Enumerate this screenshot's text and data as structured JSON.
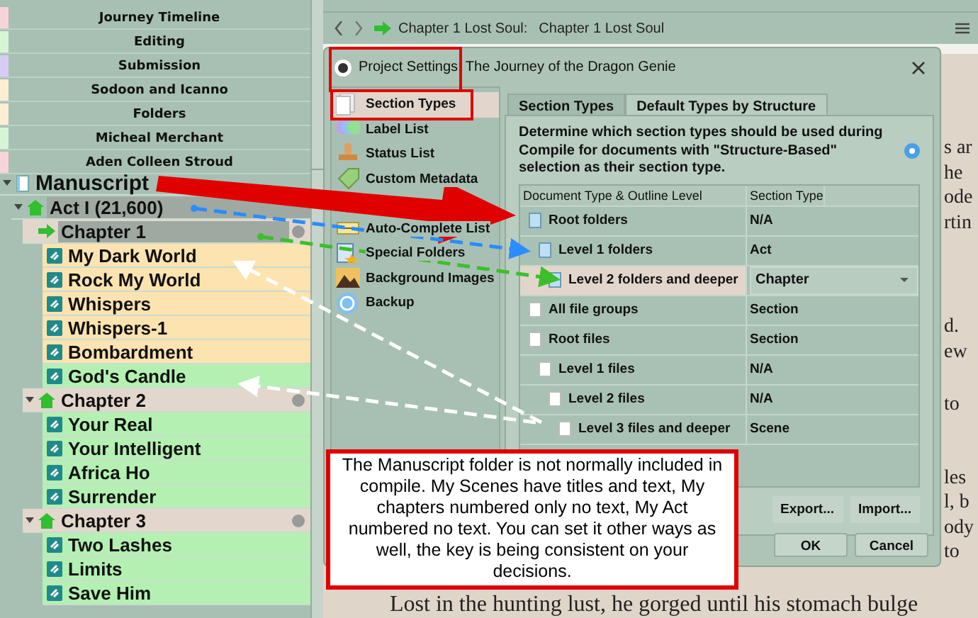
{
  "collections": [
    {
      "label": "Journey Timeline",
      "color": "#f7d3da"
    },
    {
      "label": "Editing",
      "color": "#d6f5d6"
    },
    {
      "label": "Submission",
      "color": "#d9ccf4"
    },
    {
      "label": "Sodoon and Icanno",
      "color": "#fbeed3"
    },
    {
      "label": "Folders",
      "color": "#fbeed3"
    },
    {
      "label": "Micheal Merchant",
      "color": "#d6f5d6"
    },
    {
      "label": "Aden Colleen Stroud",
      "color": "#f7d3da"
    }
  ],
  "binder": [
    {
      "label": "Manuscript",
      "kind": "draft",
      "expanded": true,
      "selected": false,
      "children": [
        {
          "label": "Act I (21,600)",
          "kind": "folder",
          "expanded": true,
          "selected": true,
          "children": [
            {
              "label": "Chapter 1",
              "kind": "current",
              "selected": true,
              "color": "#e3d7cd",
              "children": [
                {
                  "label": "My Dark World",
                  "kind": "scene",
                  "selected": false,
                  "color": "#fde3b0"
                },
                {
                  "label": "Rock My World",
                  "kind": "scene",
                  "selected": false,
                  "color": "#fde3b0"
                },
                {
                  "label": "Whispers",
                  "kind": "scene",
                  "selected": false,
                  "color": "#fde3b0"
                },
                {
                  "label": "Whispers-1",
                  "kind": "scene",
                  "selected": false,
                  "color": "#fde3b0"
                },
                {
                  "label": "Bombardment",
                  "kind": "scene",
                  "selected": false,
                  "color": "#fde3b0"
                },
                {
                  "label": "God's Candle",
                  "kind": "scene",
                  "selected": false,
                  "color": "#b4f0b2"
                }
              ]
            },
            {
              "label": "Chapter 2",
              "kind": "folder",
              "expanded": true,
              "selected": false,
              "color": "#e3d7cd",
              "children": [
                {
                  "label": "Your Real",
                  "kind": "scene",
                  "selected": false,
                  "color": "#b4f0b2"
                },
                {
                  "label": "Your Intelligent",
                  "kind": "scene",
                  "selected": false,
                  "color": "#b4f0b2"
                },
                {
                  "label": "Africa Ho",
                  "kind": "scene",
                  "selected": false,
                  "color": "#b4f0b2"
                },
                {
                  "label": "Surrender",
                  "kind": "scene",
                  "selected": false,
                  "color": "#b4f0b2"
                }
              ]
            },
            {
              "label": "Chapter 3",
              "kind": "folder",
              "expanded": true,
              "selected": false,
              "color": "#e3d7cd",
              "children": [
                {
                  "label": "Two Lashes",
                  "kind": "scene",
                  "selected": false,
                  "color": "#b4f0b2"
                },
                {
                  "label": "Limits",
                  "kind": "scene",
                  "selected": false,
                  "color": "#b4f0b2"
                },
                {
                  "label": "Save Him",
                  "kind": "scene",
                  "selected": false,
                  "color": "#b4f0b2"
                }
              ]
            }
          ]
        }
      ]
    }
  ],
  "editor": {
    "header": "Chapter 1 Lost Soul:",
    "title": "Chapter 1 Lost Soul",
    "paragraphs": [
      [
        "s ar",
        "he",
        "ode",
        "rtin"
      ],
      [
        "d.",
        "ew"
      ],
      [
        "to"
      ],
      [
        "les",
        "l, b",
        "ody",
        "to"
      ],
      [
        "Lost in the hunting lust, he gorged until his stomach bulge"
      ]
    ]
  },
  "dialog": {
    "title": "Project Settings: The Journey of the Dragon Genie",
    "sections": [
      {
        "label": "Section Types",
        "kind": "pages",
        "selected": true
      },
      {
        "label": "Label List",
        "kind": "circles",
        "selected": false
      },
      {
        "label": "Status List",
        "kind": "stamp",
        "selected": false
      },
      {
        "label": "Custom Metadata",
        "kind": "tag",
        "selected": false
      },
      {
        "kind": "covered",
        "selected": false
      },
      {
        "label": "Auto-Complete List",
        "kind": "textbox",
        "selected": false
      },
      {
        "label": "Special Folders",
        "kind": "folder-star",
        "selected": false
      },
      {
        "label": "Background Images",
        "kind": "landscape",
        "selected": false
      },
      {
        "label": "Backup",
        "kind": "backup",
        "selected": false
      }
    ],
    "tabs": [
      {
        "label": "Section Types",
        "selected": false
      },
      {
        "label": "Default Types by Structure",
        "selected": true
      }
    ],
    "description": "Determine which section types should be used during Compile for documents with \"Structure-Based\" selection as their section type.",
    "table": {
      "columns": [
        "Document Type & Outline Level",
        "Section Type"
      ],
      "rows": [
        {
          "label": "Root folders",
          "kind": "folder",
          "section_type": "N/A",
          "selected": false,
          "children": [
            {
              "label": "Level 1 folders",
              "kind": "folder",
              "section_type": "Act",
              "selected": false,
              "children": [
                {
                  "label": "Level 2 folders and deeper",
                  "kind": "folder",
                  "section_type": "Chapter",
                  "selected": true
                }
              ]
            }
          ]
        },
        {
          "label": "All file groups",
          "kind": "file",
          "section_type": "Section",
          "selected": false
        },
        {
          "label": "Root files",
          "kind": "file",
          "section_type": "Section",
          "selected": false,
          "children": [
            {
              "label": "Level 1 files",
              "kind": "file",
              "section_type": "N/A",
              "selected": false,
              "children": [
                {
                  "label": "Level 2 files",
                  "kind": "file",
                  "section_type": "N/A",
                  "selected": false,
                  "children": [
                    {
                      "label": "Level 3 files and deeper",
                      "kind": "file",
                      "section_type": "Scene",
                      "selected": false
                    }
                  ]
                }
              ]
            }
          ]
        }
      ]
    },
    "panel_buttons": [
      "Export...",
      "Import..."
    ],
    "buttons": [
      "OK",
      "Cancel"
    ]
  },
  "note": "The Manuscript folder is not normally included in compile. My Scenes have titles and text, My chapters numbered only no text, My Act numbered no text. You can set it other ways as well, the key is being consistent on your decisions."
}
